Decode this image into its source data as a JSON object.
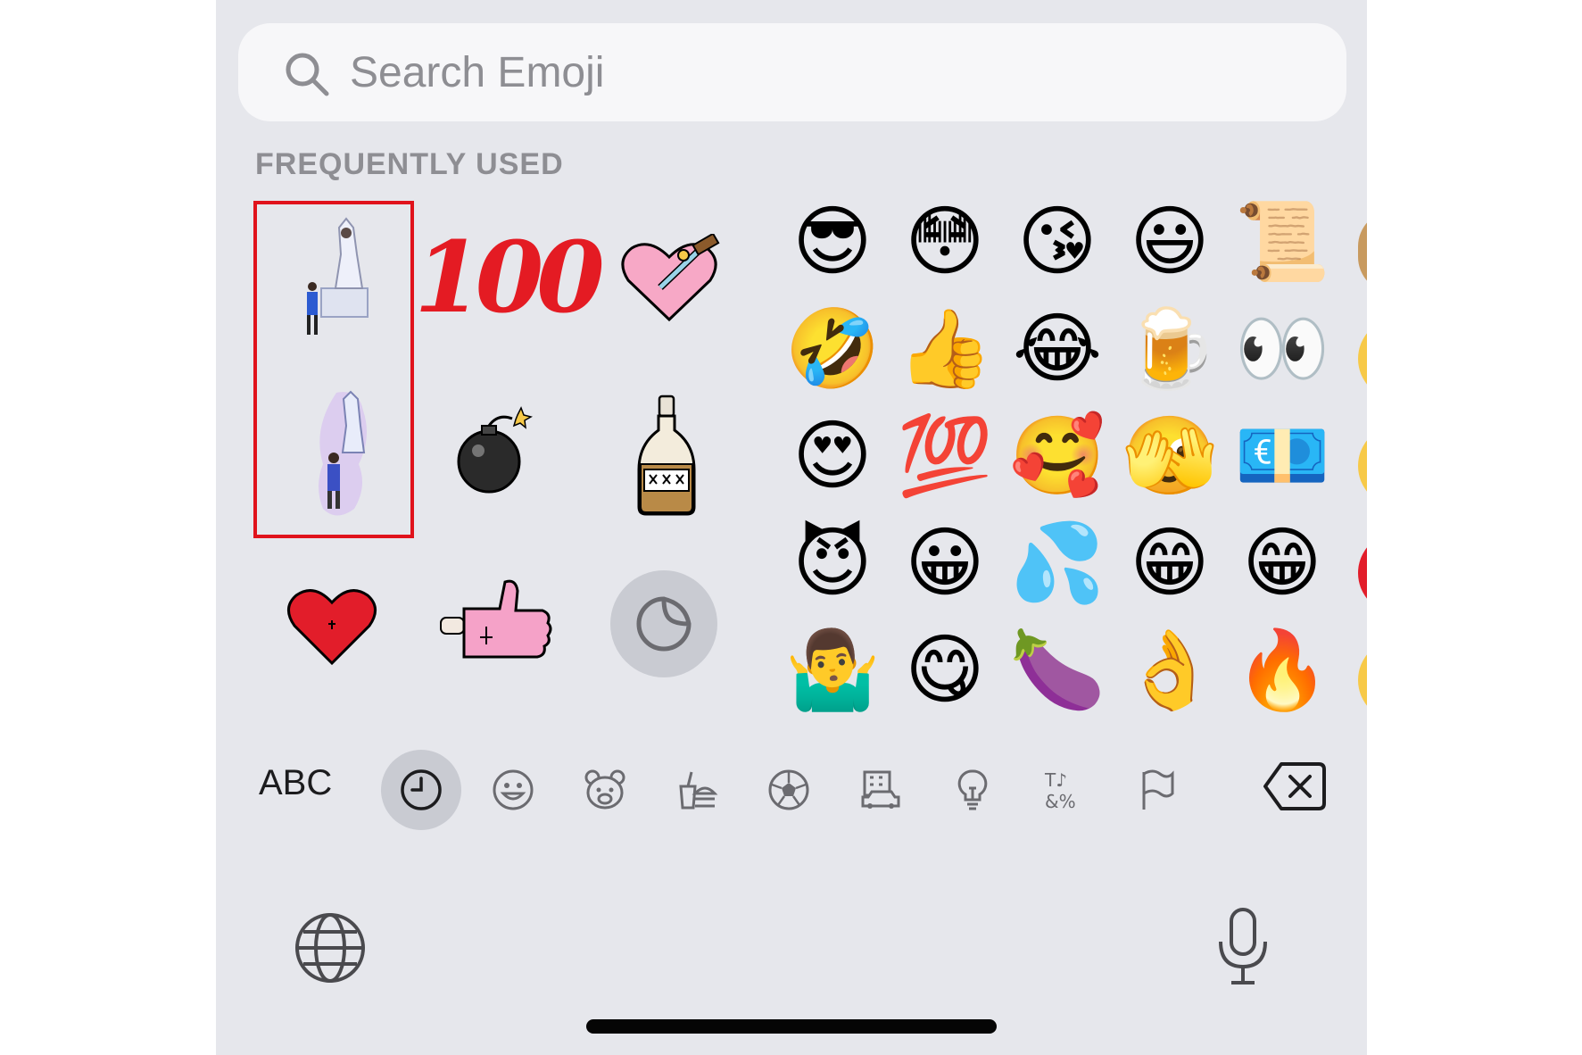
{
  "search": {
    "placeholder": "Search Emoji"
  },
  "section_title": "FREQUENTLY USED",
  "stickers": {
    "hundred_text": "100"
  },
  "emoji_grid": [
    [
      "😎",
      "😳",
      "😘",
      "😃",
      "📜"
    ],
    [
      "🤣",
      "👍",
      "😂",
      "🍺",
      "👀"
    ],
    [
      "😍",
      "💯",
      "🥰",
      "🫣",
      "💶"
    ],
    [
      "😈",
      "😀",
      "💦",
      "😁",
      "😁"
    ],
    [
      "🤷‍♂️",
      "😋",
      "🍆",
      "👌",
      "🔥"
    ]
  ],
  "category_bar": {
    "abc_label": "ABC",
    "categories": [
      {
        "name": "recents",
        "icon": "clock-icon",
        "active": true
      },
      {
        "name": "smileys",
        "icon": "smiley-icon",
        "active": false
      },
      {
        "name": "animals",
        "icon": "bear-icon",
        "active": false
      },
      {
        "name": "food",
        "icon": "burger-icon",
        "active": false
      },
      {
        "name": "activity",
        "icon": "soccer-ball-icon",
        "active": false
      },
      {
        "name": "travel",
        "icon": "building-car-icon",
        "active": false
      },
      {
        "name": "objects",
        "icon": "lightbulb-icon",
        "active": false
      },
      {
        "name": "symbols",
        "icon": "symbols-icon",
        "active": false
      },
      {
        "name": "flags",
        "icon": "flag-icon",
        "active": false
      }
    ],
    "delete_icon": "delete-backspace-icon"
  },
  "bottom": {
    "globe_icon": "globe-icon",
    "mic_icon": "microphone-icon"
  },
  "colors": {
    "background": "#e6e7ec",
    "selection": "#e0131c",
    "active_category": "#c9cbd2"
  }
}
